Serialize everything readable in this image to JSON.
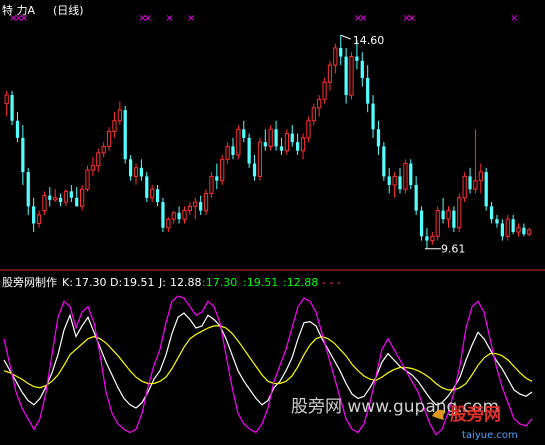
{
  "top_header": {
    "name": "特  力A",
    "period": "(日线)"
  },
  "bottom_header": {
    "title": "股旁网制作",
    "k_label": "K:",
    "k_value": "17.30",
    "d_label": "D:",
    "d_value": "19.51",
    "j_label": "J:",
    "j_value": "12.88",
    "extra1": ":17.30",
    "extra2": ":19.51",
    "extra3": ":12.88",
    "dashes": "-  -  -"
  },
  "annotations": {
    "high": "14.60",
    "low": "9.61"
  },
  "watermark": {
    "text": "股旁网  www.gupang.com",
    "logo_cn": "股旁网",
    "logo_en": "taiyue.com"
  },
  "colors": {
    "background": "#000000",
    "up": "#ff3030",
    "down": "#54ffff",
    "divider": "#c83030",
    "k_line": "#ffffff",
    "d_line": "#ffff00",
    "j_line": "#ff00ff",
    "signal_marker": "#ff00ff",
    "extra_values": "#00ff00",
    "label": "#ffffff"
  },
  "chart_data": [
    {
      "type": "candlestick",
      "title": "特  力A (日线)",
      "ylim": [
        9.3,
        15.0
      ],
      "annotations": [
        {
          "label": "14.60",
          "kind": "high"
        },
        {
          "label": "9.61",
          "kind": "low"
        }
      ],
      "markers": {
        "type": "x",
        "color": "#ff00ff",
        "count": 12
      },
      "candles": [
        [
          13.0,
          13.3,
          12.7,
          13.2
        ],
        [
          13.2,
          13.3,
          12.5,
          12.6
        ],
        [
          12.6,
          12.8,
          12.1,
          12.2
        ],
        [
          12.2,
          12.5,
          11.1,
          11.4
        ],
        [
          11.4,
          11.5,
          10.4,
          10.6
        ],
        [
          10.6,
          10.8,
          10.0,
          10.2
        ],
        [
          10.2,
          10.5,
          10.1,
          10.4
        ],
        [
          10.5,
          10.95,
          10.4,
          10.85
        ],
        [
          10.85,
          11.05,
          10.6,
          10.75
        ],
        [
          10.75,
          11.0,
          10.7,
          10.8
        ],
        [
          10.8,
          10.9,
          10.6,
          10.7
        ],
        [
          10.7,
          11.0,
          10.6,
          10.95
        ],
        [
          10.95,
          11.1,
          10.7,
          10.8
        ],
        [
          10.8,
          11.05,
          10.6,
          10.6
        ],
        [
          10.6,
          11.1,
          10.5,
          11.0
        ],
        [
          11.0,
          11.55,
          10.95,
          11.45
        ],
        [
          11.45,
          11.75,
          11.3,
          11.55
        ],
        [
          11.55,
          11.95,
          11.4,
          11.85
        ],
        [
          11.85,
          12.1,
          11.75,
          12.0
        ],
        [
          12.0,
          12.45,
          11.9,
          12.35
        ],
        [
          12.35,
          12.8,
          12.2,
          12.6
        ],
        [
          12.6,
          13.05,
          12.5,
          12.85
        ],
        [
          12.85,
          12.95,
          11.6,
          11.7
        ],
        [
          11.7,
          11.8,
          11.2,
          11.3
        ],
        [
          11.3,
          11.6,
          11.1,
          11.5
        ],
        [
          11.5,
          11.7,
          11.2,
          11.3
        ],
        [
          11.3,
          11.4,
          10.7,
          10.8
        ],
        [
          10.8,
          11.1,
          10.7,
          11.0
        ],
        [
          11.0,
          11.1,
          10.6,
          10.7
        ],
        [
          10.7,
          10.8,
          10.0,
          10.1
        ],
        [
          10.1,
          10.35,
          10.0,
          10.3
        ],
        [
          10.3,
          10.5,
          10.2,
          10.45
        ],
        [
          10.45,
          10.6,
          10.2,
          10.3
        ],
        [
          10.3,
          10.6,
          10.2,
          10.5
        ],
        [
          10.5,
          10.7,
          10.4,
          10.6
        ],
        [
          10.6,
          10.8,
          10.3,
          10.7
        ],
        [
          10.7,
          10.85,
          10.4,
          10.5
        ],
        [
          10.5,
          11.0,
          10.4,
          10.9
        ],
        [
          10.9,
          11.4,
          10.8,
          11.3
        ],
        [
          11.3,
          11.6,
          11.0,
          11.2
        ],
        [
          11.2,
          11.8,
          11.1,
          11.7
        ],
        [
          11.7,
          12.1,
          11.6,
          12.0
        ],
        [
          12.0,
          12.2,
          11.7,
          11.8
        ],
        [
          11.8,
          12.5,
          11.7,
          12.4
        ],
        [
          12.4,
          12.6,
          12.1,
          12.2
        ],
        [
          12.2,
          12.3,
          11.5,
          11.6
        ],
        [
          11.6,
          11.8,
          11.2,
          11.3
        ],
        [
          11.3,
          12.2,
          11.2,
          12.1
        ],
        [
          12.1,
          12.4,
          11.9,
          12.0
        ],
        [
          12.0,
          12.5,
          11.9,
          12.4
        ],
        [
          12.4,
          12.6,
          11.9,
          12.0
        ],
        [
          12.0,
          12.2,
          11.8,
          11.9
        ],
        [
          11.9,
          12.4,
          11.8,
          12.3
        ],
        [
          12.3,
          12.5,
          12.0,
          12.1
        ],
        [
          12.1,
          12.3,
          11.8,
          11.9
        ],
        [
          11.9,
          12.3,
          11.7,
          12.2
        ],
        [
          12.2,
          12.7,
          12.1,
          12.6
        ],
        [
          12.6,
          13.0,
          12.5,
          12.9
        ],
        [
          12.9,
          13.2,
          12.7,
          13.1
        ],
        [
          13.1,
          13.6,
          13.0,
          13.5
        ],
        [
          13.5,
          14.0,
          13.3,
          13.9
        ],
        [
          13.9,
          14.4,
          13.7,
          14.3
        ],
        [
          14.3,
          14.6,
          13.9,
          14.1
        ],
        [
          14.1,
          14.3,
          13.0,
          13.2
        ],
        [
          13.2,
          14.2,
          13.1,
          14.1
        ],
        [
          14.1,
          14.5,
          13.8,
          14.0
        ],
        [
          14.0,
          14.2,
          13.4,
          13.6
        ],
        [
          13.6,
          13.9,
          12.8,
          13.0
        ],
        [
          13.0,
          13.2,
          12.2,
          12.4
        ],
        [
          12.4,
          12.6,
          11.8,
          12.0
        ],
        [
          12.0,
          12.1,
          11.2,
          11.3
        ],
        [
          11.3,
          11.5,
          10.9,
          11.1
        ],
        [
          11.1,
          11.4,
          10.8,
          11.3
        ],
        [
          11.3,
          11.5,
          10.9,
          11.0
        ],
        [
          11.0,
          11.7,
          10.9,
          11.6
        ],
        [
          11.6,
          11.7,
          11.0,
          11.1
        ],
        [
          11.1,
          11.3,
          10.4,
          10.5
        ],
        [
          10.5,
          10.6,
          9.8,
          9.9
        ],
        [
          9.9,
          10.1,
          9.61,
          9.8
        ],
        [
          9.8,
          10.0,
          9.7,
          9.9
        ],
        [
          9.9,
          10.6,
          9.8,
          10.5
        ],
        [
          10.5,
          10.8,
          10.2,
          10.3
        ],
        [
          10.3,
          10.6,
          10.1,
          10.5
        ],
        [
          10.5,
          10.6,
          10.0,
          10.1
        ],
        [
          10.1,
          10.9,
          10.0,
          10.8
        ],
        [
          10.8,
          11.4,
          10.7,
          11.3
        ],
        [
          11.3,
          11.5,
          10.9,
          11.0
        ],
        [
          11.0,
          12.4,
          10.9,
          11.2
        ],
        [
          11.2,
          11.6,
          10.9,
          11.4
        ],
        [
          11.4,
          11.5,
          10.5,
          10.6
        ],
        [
          10.6,
          10.7,
          10.2,
          10.3
        ],
        [
          10.3,
          10.4,
          10.1,
          10.2
        ],
        [
          10.2,
          10.3,
          9.8,
          9.9
        ],
        [
          9.9,
          10.4,
          9.8,
          10.3
        ],
        [
          10.3,
          10.4,
          9.95,
          10.0
        ],
        [
          10.0,
          10.2,
          9.9,
          10.1
        ],
        [
          10.1,
          10.2,
          9.9,
          9.95
        ],
        [
          9.95,
          10.1,
          9.9,
          10.05
        ]
      ]
    },
    {
      "type": "line",
      "title": "股旁网制作",
      "ylim": [
        -25,
        110
      ],
      "series": [
        {
          "name": "K",
          "color": "#ffffff",
          "values": [
            50,
            40,
            30,
            20,
            12,
            8,
            14,
            25,
            38,
            55,
            78,
            92,
            72,
            82,
            90,
            76,
            62,
            48,
            36,
            24,
            14,
            8,
            5,
            10,
            20,
            32,
            40,
            55,
            75,
            90,
            94,
            88,
            80,
            82,
            92,
            88,
            82,
            70,
            55,
            40,
            30,
            22,
            14,
            8,
            12,
            24,
            30,
            40,
            52,
            70,
            85,
            86,
            82,
            70,
            60,
            50,
            40,
            28,
            18,
            14,
            16,
            24,
            34,
            48,
            56,
            50,
            44,
            40,
            36,
            30,
            22,
            14,
            8,
            10,
            16,
            24,
            34,
            50,
            64,
            76,
            70,
            60,
            50,
            42,
            32,
            22,
            18,
            16,
            20
          ]
        },
        {
          "name": "D",
          "color": "#ffff00",
          "values": [
            40,
            38,
            35,
            32,
            28,
            25,
            24,
            26,
            30,
            36,
            45,
            55,
            60,
            65,
            70,
            72,
            70,
            66,
            60,
            54,
            47,
            40,
            34,
            30,
            28,
            28,
            30,
            34,
            42,
            52,
            62,
            70,
            74,
            77,
            80,
            82,
            82,
            80,
            75,
            68,
            60,
            52,
            44,
            36,
            30,
            28,
            28,
            30,
            35,
            44,
            55,
            64,
            70,
            72,
            70,
            66,
            60,
            54,
            46,
            40,
            35,
            32,
            31,
            34,
            38,
            41,
            43,
            43,
            42,
            40,
            37,
            33,
            28,
            24,
            22,
            22,
            24,
            28,
            36,
            45,
            52,
            56,
            56,
            54,
            50,
            44,
            38,
            33,
            30
          ]
        },
        {
          "name": "J",
          "color": "#ff00ff",
          "values": [
            70,
            45,
            20,
            5,
            -5,
            -15,
            -5,
            20,
            55,
            90,
            105,
            100,
            80,
            95,
            100,
            85,
            55,
            20,
            0,
            -10,
            -15,
            -18,
            -15,
            0,
            25,
            45,
            60,
            85,
            105,
            110,
            108,
            100,
            92,
            95,
            105,
            100,
            85,
            55,
            25,
            0,
            -10,
            -15,
            -18,
            -10,
            5,
            30,
            45,
            60,
            80,
            100,
            108,
            105,
            95,
            75,
            55,
            35,
            15,
            -5,
            -15,
            -18,
            -10,
            10,
            35,
            60,
            70,
            60,
            50,
            40,
            30,
            20,
            5,
            -10,
            -20,
            -15,
            0,
            20,
            45,
            80,
            100,
            105,
            95,
            70,
            45,
            25,
            10,
            -5,
            -10,
            -12,
            -5
          ]
        }
      ]
    }
  ]
}
